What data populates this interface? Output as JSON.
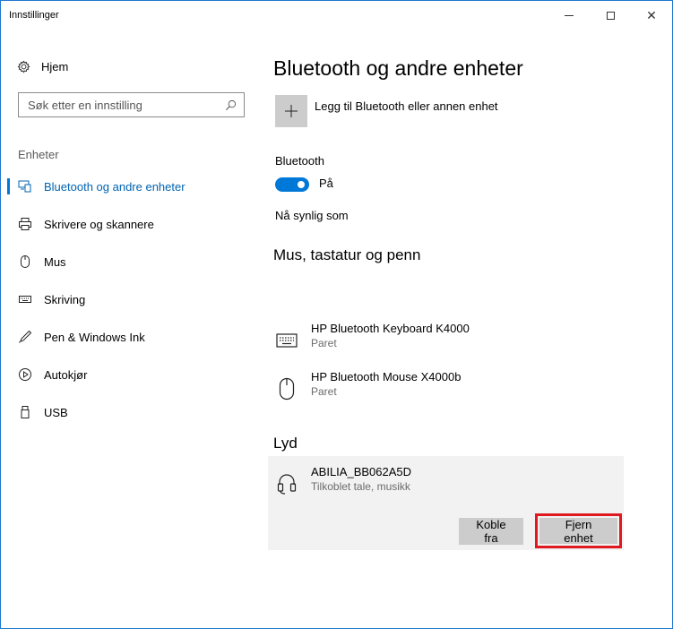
{
  "window": {
    "title": "Innstillinger",
    "controls": {
      "minimize": "—",
      "maximize": "□",
      "close": "✕"
    }
  },
  "sidebar": {
    "home_label": "Hjem",
    "search_placeholder": "Søk etter en innstilling",
    "section_label": "Enheter",
    "items": [
      {
        "label": "Bluetooth og andre enheter",
        "icon": "bluetooth-devices-icon",
        "selected": true
      },
      {
        "label": "Skrivere og skannere",
        "icon": "printer-icon",
        "selected": false
      },
      {
        "label": "Mus",
        "icon": "mouse-icon",
        "selected": false
      },
      {
        "label": "Skriving",
        "icon": "keyboard-icon",
        "selected": false
      },
      {
        "label": "Pen & Windows Ink",
        "icon": "pen-icon",
        "selected": false
      },
      {
        "label": "Autokjør",
        "icon": "autoplay-icon",
        "selected": false
      },
      {
        "label": "USB",
        "icon": "usb-icon",
        "selected": false
      }
    ]
  },
  "main": {
    "title": "Bluetooth og andre enheter",
    "add_device_label": "Legg til Bluetooth eller annen enhet",
    "bluetooth_label": "Bluetooth",
    "bluetooth_state": "På",
    "visible_as_label": "Nå synlig som",
    "sections": {
      "input_heading": "Mus, tastatur og penn",
      "input_devices": [
        {
          "name": "HP Bluetooth Keyboard K4000",
          "status": "Paret",
          "icon": "keyboard-icon"
        },
        {
          "name": "HP Bluetooth Mouse X4000b",
          "status": "Paret",
          "icon": "mouse-icon"
        }
      ],
      "audio_heading": "Lyd",
      "audio_device": {
        "name": "ABILIA_BB062A5D",
        "status": "Tilkoblet tale, musikk",
        "icon": "headset-icon"
      },
      "disconnect_label": "Koble fra",
      "remove_label": "Fjern enhet"
    }
  },
  "colors": {
    "accent": "#0078d7",
    "highlight_border": "#e0181f",
    "panel_bg": "#f2f2f2",
    "button_bg": "#cccccc"
  }
}
